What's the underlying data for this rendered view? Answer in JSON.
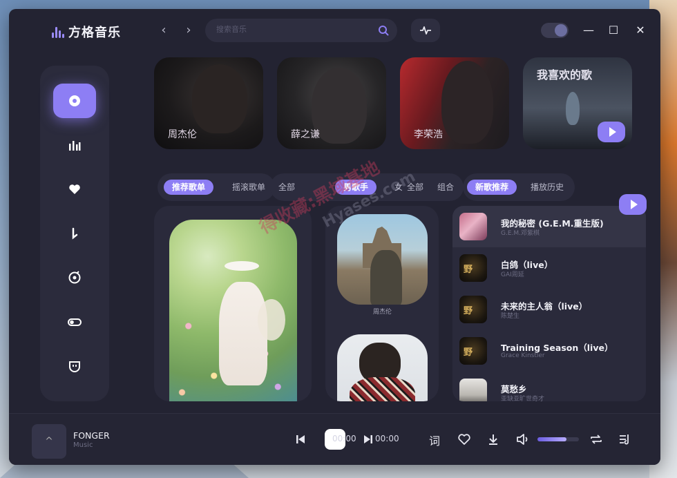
{
  "app": {
    "name": "方格音乐"
  },
  "search": {
    "placeholder": "搜索音乐"
  },
  "banner_cards": [
    {
      "label": "周杰伦"
    },
    {
      "label": "薛之谦"
    },
    {
      "label": "李荣浩"
    },
    {
      "label": "我喜欢的歌"
    }
  ],
  "tabs": {
    "playlists": [
      "推荐歌单",
      "摇滚歌单"
    ],
    "singers": [
      "全部",
      "男歌手",
      "女",
      "全部",
      "组合"
    ],
    "songs": [
      "新歌推荐",
      "播放历史"
    ]
  },
  "singers": [
    {
      "name": "周杰伦"
    }
  ],
  "songs": [
    {
      "title": "我的秘密 (G.E.M.重生版)",
      "artist": "G.E.M.邓紫棋",
      "thumb": "pink"
    },
    {
      "title": "白鸽（live）",
      "artist": "GAI周延",
      "thumb": "dark",
      "thumb_text": "野"
    },
    {
      "title": "未来的主人翁（live）",
      "artist": "陈楚生",
      "thumb": "dark",
      "thumb_text": "野"
    },
    {
      "title": "Training Season（live）",
      "artist": "Grace Kinstler",
      "thumb": "dark",
      "thumb_text": "野"
    },
    {
      "title": "莫愁乡",
      "artist": "亚缺亚旷世奇才",
      "thumb": "gray"
    }
  ],
  "player": {
    "track": "FONGER",
    "subtitle": "Music",
    "expand_glyph": "^",
    "current_time": "00:00",
    "total_time": "00:00",
    "lyrics_label": "词",
    "volume": 0.7
  },
  "watermark": {
    "text": "得收藏:黑域基地",
    "url": "Hyases.com"
  },
  "colors": {
    "accent": "#8d7ef4",
    "window_bg": "#232332",
    "panel_bg": "#2a2a3b"
  }
}
